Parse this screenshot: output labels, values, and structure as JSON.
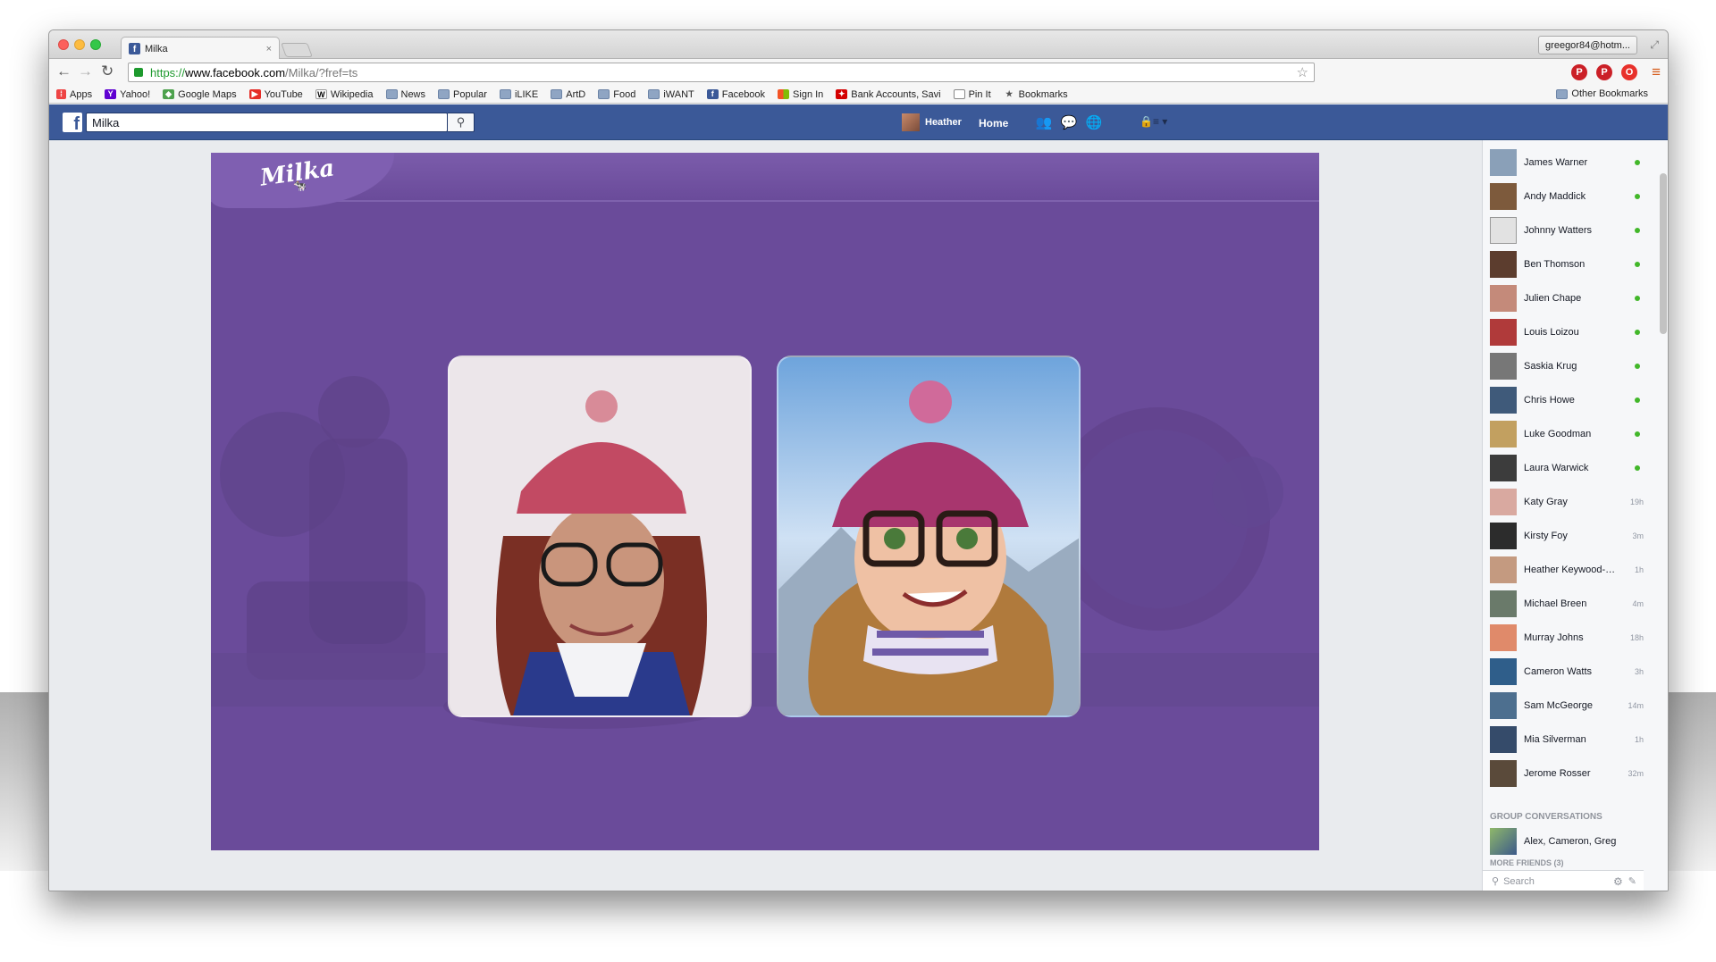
{
  "browser": {
    "tab_title": "Milka",
    "tab_close": "×",
    "profile": "greegor84@hotm...",
    "url_scheme": "https://",
    "url_host": "www.facebook.com",
    "url_path": "/Milka/?fref=ts"
  },
  "bookmarks": {
    "items": [
      {
        "label": "Apps",
        "icon": "apps-grid-icon"
      },
      {
        "label": "Yahoo!",
        "icon": "yahoo-icon"
      },
      {
        "label": "Google Maps",
        "icon": "google-maps-icon"
      },
      {
        "label": "YouTube",
        "icon": "youtube-icon"
      },
      {
        "label": "Wikipedia",
        "icon": "wikipedia-icon"
      },
      {
        "label": "News",
        "icon": "folder-icon"
      },
      {
        "label": "Popular",
        "icon": "folder-icon"
      },
      {
        "label": "iLIKE",
        "icon": "folder-icon"
      },
      {
        "label": "ArtD",
        "icon": "folder-icon"
      },
      {
        "label": "Food",
        "icon": "folder-icon"
      },
      {
        "label": "iWANT",
        "icon": "folder-icon"
      },
      {
        "label": "Facebook",
        "icon": "facebook-icon"
      },
      {
        "label": "Sign In",
        "icon": "microsoft-icon"
      },
      {
        "label": "Bank Accounts, Savi",
        "icon": "bank-icon"
      },
      {
        "label": "Pin It",
        "icon": "page-icon"
      },
      {
        "label": "Bookmarks",
        "icon": "star-icon"
      }
    ],
    "other": "Other Bookmarks"
  },
  "facebook": {
    "search_value": "Milka",
    "user_name": "Heather",
    "home_label": "Home"
  },
  "sidebar": {
    "friends": [
      {
        "name": "James Warner",
        "status": "online"
      },
      {
        "name": "Andy Maddick",
        "status": "online"
      },
      {
        "name": "Johnny Watters",
        "status": "online"
      },
      {
        "name": "Ben Thomson",
        "status": "online"
      },
      {
        "name": "Julien Chape",
        "status": "online"
      },
      {
        "name": "Louis Loizou",
        "status": "online"
      },
      {
        "name": "Saskia Krug",
        "status": "online"
      },
      {
        "name": "Chris Howe",
        "status": "online"
      },
      {
        "name": "Luke Goodman",
        "status": "online"
      },
      {
        "name": "Laura Warwick",
        "status": "online"
      },
      {
        "name": "Katy Gray",
        "status": "19h"
      },
      {
        "name": "Kirsty Foy",
        "status": "3m"
      },
      {
        "name": "Heather Keywood-Mi...",
        "status": "1h"
      },
      {
        "name": "Michael Breen",
        "status": "4m"
      },
      {
        "name": "Murray Johns",
        "status": "18h"
      },
      {
        "name": "Cameron Watts",
        "status": "3h"
      },
      {
        "name": "Sam McGeorge",
        "status": "14m"
      },
      {
        "name": "Mia Silverman",
        "status": "1h"
      },
      {
        "name": "Jerome Rosser",
        "status": "32m"
      }
    ],
    "group_heading": "GROUP CONVERSATIONS",
    "group_name": "Alex, Cameron, Greg",
    "more_friends": "MORE FRIENDS (3)",
    "search_placeholder": "Search"
  },
  "colors": {
    "facebook_blue": "#3b5998",
    "milka_purple": "#6a4b9a",
    "online_green": "#42b72a"
  }
}
